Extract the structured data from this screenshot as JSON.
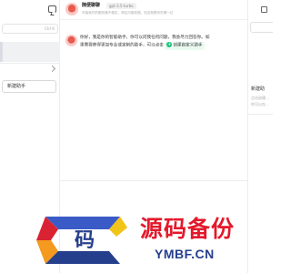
{
  "sidebar": {
    "search_shortcut": "Ctrl K",
    "new_assistant_label": "新建助手"
  },
  "header": {
    "assistant_name": "随便聊聊",
    "model_tag": "gpt-3.5-turbo",
    "description": "可能我们的服务器不稳定，响应可能较慢，但这就是你的第一位"
  },
  "message": {
    "line1": "你好，我是你的智能助手，你可以问我任何问题，我会尽力回答你。如",
    "line2_prefix": "果需要获得更加专业或定制的助手，可以点击",
    "create_label": "创建自定义助手",
    "create_plus": "+"
  },
  "right_panel": {
    "title": "新建助",
    "sub1": "点击创建...",
    "sub2": "你可以在..."
  },
  "watermark": {
    "cn": "源码备份",
    "en": "YMBF.CN",
    "glyph": "码"
  },
  "colors": {
    "accent_green": "#19c37d",
    "watermark_red": "#e3192b",
    "watermark_blue": "#263f8c"
  }
}
